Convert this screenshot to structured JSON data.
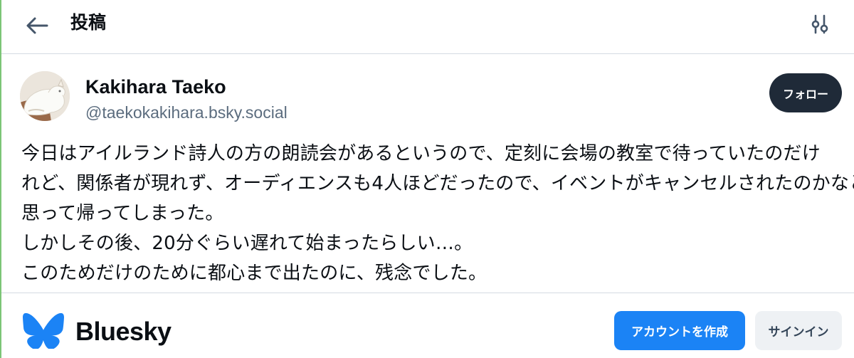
{
  "header": {
    "title": "投稿",
    "back_icon": "arrow-left-icon",
    "settings_icon": "sliders-icon"
  },
  "post": {
    "author": {
      "display_name": "Kakihara Taeko",
      "handle": "@taekokakihara.bsky.social"
    },
    "follow_label": "フォロー",
    "text_lines": [
      "今日はアイルランド詩人の方の朗読会があるというので、定刻に会場の教室で待っていたのだけ",
      "れど、関係者が現れず、オーディエンスも4人ほどだったので、イベントがキャンセルされたのかなと",
      "思って帰ってしまった。",
      "しかしその後、20分ぐらい遅れて始まったらしい…。",
      "このためだけのために都心まで出たのに、残念でした。"
    ]
  },
  "footer": {
    "brand": "Bluesky",
    "create_account_label": "アカウントを作成",
    "sign_in_label": "サインイン"
  },
  "colors": {
    "accent": "#1b83f5",
    "follow_bg": "#1f2a38",
    "secondary_text": "#5b6c7e",
    "divider": "#d4dbe2"
  }
}
